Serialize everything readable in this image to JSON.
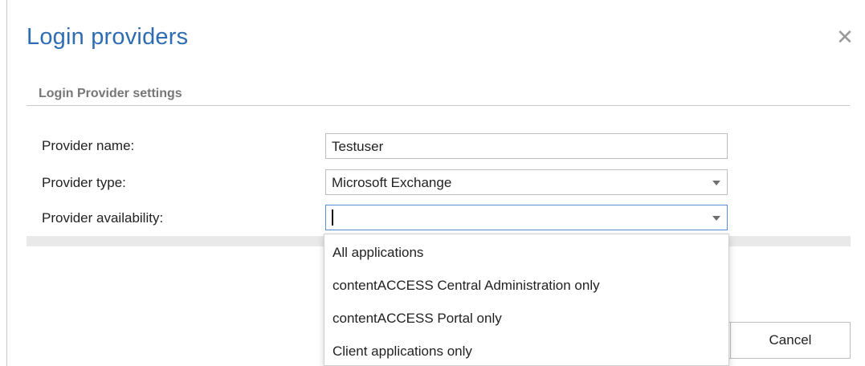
{
  "dialog": {
    "title": "Login providers",
    "close_icon": "close-icon"
  },
  "section": {
    "header": "Login Provider settings"
  },
  "form": {
    "provider_name": {
      "label": "Provider name:",
      "value": "Testuser"
    },
    "provider_type": {
      "label": "Provider type:",
      "value": "Microsoft Exchange"
    },
    "provider_availability": {
      "label": "Provider availability:",
      "value": ""
    }
  },
  "dropdown": {
    "options": [
      "All applications",
      "contentACCESS Central Administration only",
      "contentACCESS Portal only",
      "Client applications only"
    ]
  },
  "buttons": {
    "cancel": "Cancel"
  },
  "colors": {
    "title": "#2f6db3",
    "focus_border": "#5a8fd6"
  }
}
